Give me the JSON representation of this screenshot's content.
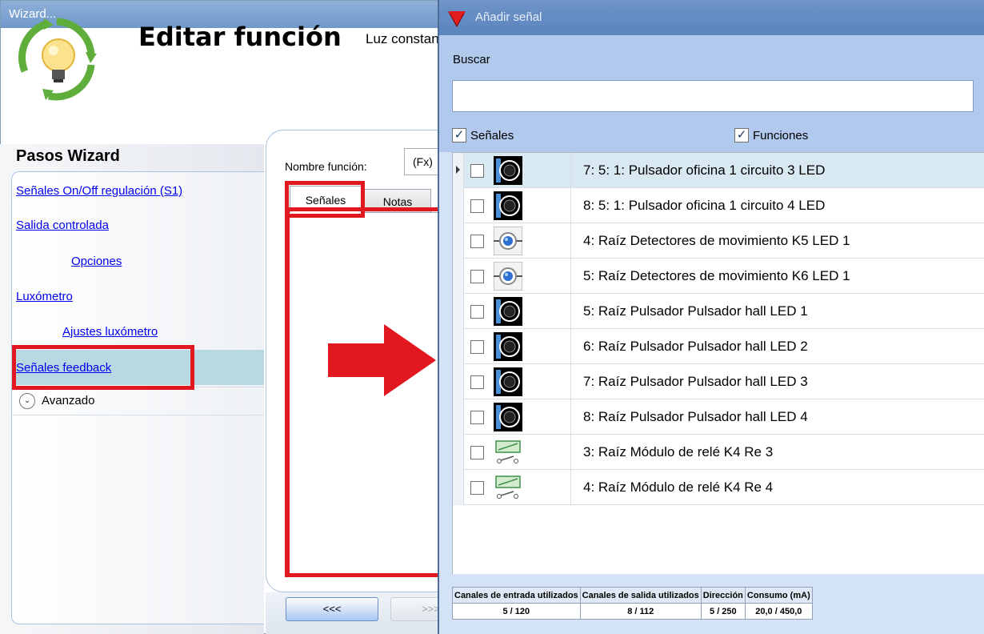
{
  "wizard": {
    "window_title": "Wizard...",
    "title": "Editar función",
    "subtitle": "Luz constante",
    "steps_title": "Pasos Wizard",
    "steps": [
      {
        "label": "Señales On/Off regulación (S1)"
      },
      {
        "label": "Salida controlada"
      },
      {
        "label": "Opciones"
      },
      {
        "label": "Luxómetro"
      },
      {
        "label": "Ajustes luxómetro"
      },
      {
        "label": "Señales feedback"
      }
    ],
    "advanced_label": "Avanzado",
    "function_name_label": "Nombre función:",
    "function_name_value": "(Fx)",
    "tabs": [
      {
        "label": "Señales"
      },
      {
        "label": "Notas"
      }
    ],
    "back_button": "<<<",
    "next_button": ">>>",
    "colors": {
      "annotation": "#e1181f",
      "selected_step": "#b8d8e4"
    }
  },
  "dialog": {
    "title": "Añadir señal",
    "search_label": "Buscar",
    "search_value": "",
    "filter_signals": {
      "label": "Señales",
      "checked": true
    },
    "filter_functions": {
      "label": "Funciones",
      "checked": true
    },
    "rows": [
      {
        "text": "7: 5: 1: Pulsador oficina 1 circuito 3 LED",
        "icon": "push-button-icon",
        "selected": true
      },
      {
        "text": "8: 5: 1: Pulsador oficina 1 circuito 4 LED",
        "icon": "push-button-icon"
      },
      {
        "text": "4: Raíz Detectores de movimiento K5 LED 1",
        "icon": "motion-detector-icon"
      },
      {
        "text": "5: Raíz Detectores de movimiento K6 LED 1",
        "icon": "motion-detector-icon"
      },
      {
        "text": "5: Raíz Pulsador Pulsador hall LED 1",
        "icon": "push-button-icon"
      },
      {
        "text": "6: Raíz Pulsador Pulsador hall LED 2",
        "icon": "push-button-icon"
      },
      {
        "text": "7: Raíz Pulsador Pulsador hall LED 3",
        "icon": "push-button-icon"
      },
      {
        "text": "8: Raíz Pulsador Pulsador hall LED 4",
        "icon": "push-button-icon"
      },
      {
        "text": "3: Raíz Módulo de relé K4 Re 3",
        "icon": "relay-icon"
      },
      {
        "text": "4: Raíz Módulo de relé K4 Re 4",
        "icon": "relay-icon"
      }
    ],
    "stats": {
      "headers": [
        "Canales de entrada utilizados",
        "Canales de salida utilizados",
        "Dirección",
        "Consumo (mA)"
      ],
      "values": [
        "5 / 120",
        "8 / 112",
        "5 / 250",
        "20,0 / 450,0"
      ]
    }
  }
}
